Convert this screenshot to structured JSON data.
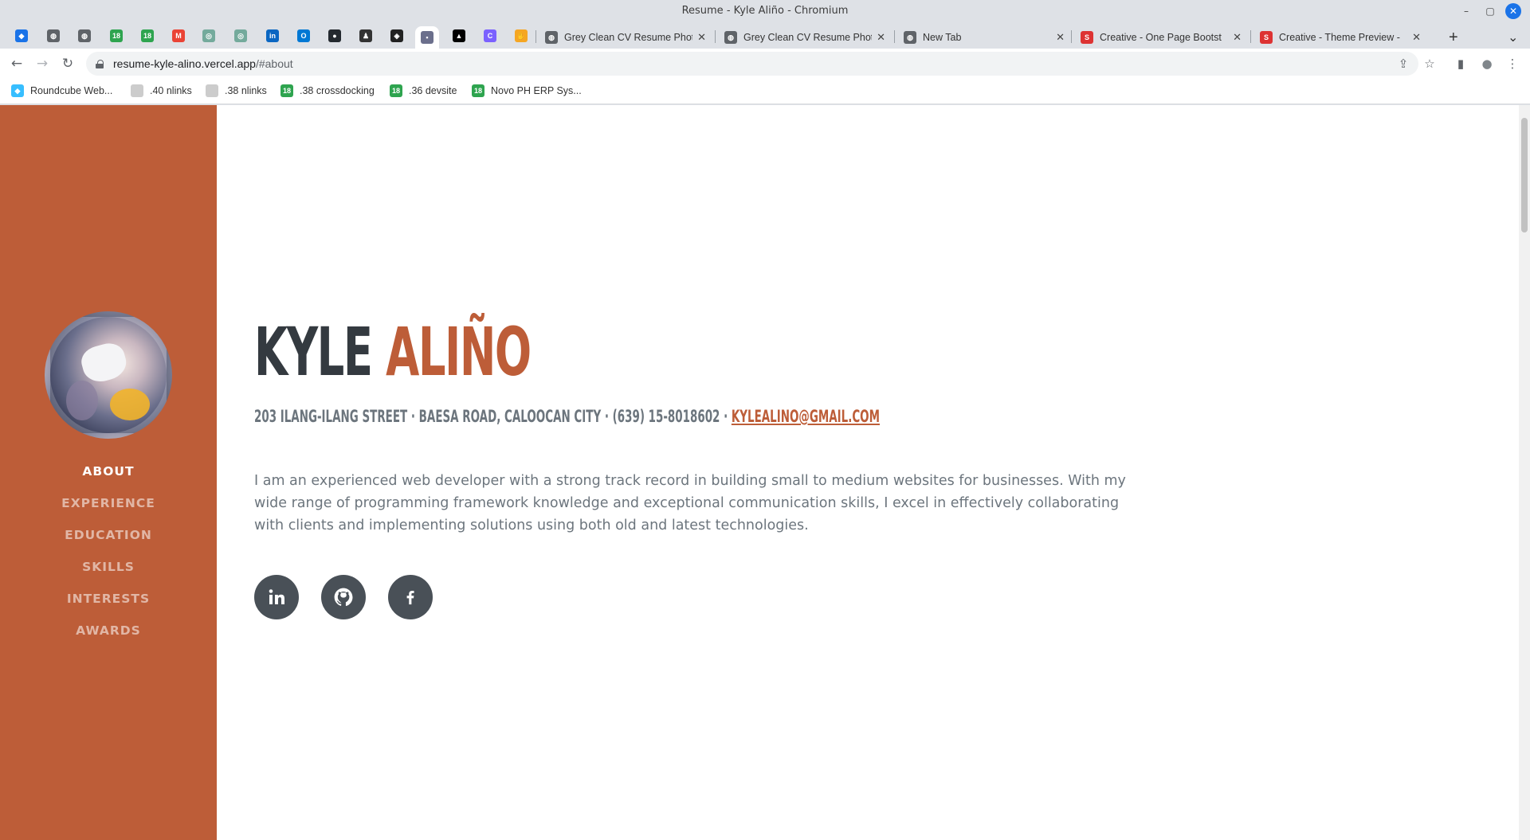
{
  "window": {
    "title": "Resume - Kyle Aliño - Chromium",
    "minimize": "–",
    "maximize": "▢",
    "close": "✕"
  },
  "pinned_tabs": [
    {
      "icon": "bird-icon",
      "color": "#1a73e8",
      "glyph": "◆"
    },
    {
      "icon": "globe-icon",
      "color": "#5f6368",
      "glyph": "◍"
    },
    {
      "icon": "globe-icon",
      "color": "#5f6368",
      "glyph": "◍"
    },
    {
      "icon": "tracker-icon",
      "color": "#2ea44f",
      "glyph": "18"
    },
    {
      "icon": "tracker-icon",
      "color": "#2ea44f",
      "glyph": "18"
    },
    {
      "icon": "gmail-icon",
      "color": "#ea4335",
      "glyph": "M"
    },
    {
      "icon": "chatgpt-icon",
      "color": "#74aa9c",
      "glyph": "◎"
    },
    {
      "icon": "chatgpt-icon",
      "color": "#74aa9c",
      "glyph": "◎"
    },
    {
      "icon": "linkedin-icon",
      "color": "#0a66c2",
      "glyph": "in"
    },
    {
      "icon": "outlook-icon",
      "color": "#0078d4",
      "glyph": "O"
    },
    {
      "icon": "github-icon",
      "color": "#24292f",
      "glyph": "●"
    },
    {
      "icon": "agent-icon",
      "color": "#333333",
      "glyph": "♟"
    },
    {
      "icon": "owl-icon",
      "color": "#222222",
      "glyph": "◈"
    },
    {
      "icon": "profile-photo-icon",
      "color": "#6b6f8c",
      "glyph": "▪"
    },
    {
      "icon": "vercel-icon",
      "color": "#000000",
      "glyph": "▲"
    },
    {
      "icon": "canva-icon",
      "color": "#7b61ff",
      "glyph": "C"
    },
    {
      "icon": "hand-icon",
      "color": "#f5a623",
      "glyph": "✋"
    }
  ],
  "tabs": [
    {
      "label": "Grey Clean CV Resume Phot",
      "icon": "globe-icon",
      "color": "#5f6368",
      "glyph": "◍"
    },
    {
      "label": "Grey Clean CV Resume Phot",
      "icon": "globe-icon",
      "color": "#5f6368",
      "glyph": "◍"
    },
    {
      "label": "New Tab",
      "icon": "globe-icon",
      "color": "#5f6368",
      "glyph": "◍"
    },
    {
      "label": "Creative - One Page Bootst",
      "icon": "startbootstrap-icon",
      "color": "#dd3333",
      "glyph": "S"
    },
    {
      "label": "Creative - Theme Preview -",
      "icon": "startbootstrap-icon",
      "color": "#dd3333",
      "glyph": "S"
    }
  ],
  "tab_close": "✕",
  "new_tab": "+",
  "tab_search": "⌄",
  "address": {
    "host": "resume-kyle-alino.vercel.app",
    "path": "/#about"
  },
  "nav_glyphs": {
    "back": "←",
    "forward": "→",
    "reload": "↻",
    "share": "⇪",
    "star": "☆",
    "sidepanel": "▮",
    "profile": "●",
    "menu": "⋮"
  },
  "bookmarks": [
    {
      "label": "Roundcube Web...",
      "icon": "roundcube-icon",
      "color": "#37beff",
      "glyph": "◆"
    },
    {
      "label": ".40 nlinks",
      "icon": "page-icon",
      "color": "#cccccc",
      "glyph": ""
    },
    {
      "label": ".38 nlinks",
      "icon": "page-icon",
      "color": "#cccccc",
      "glyph": ""
    },
    {
      "label": ".38 crossdocking",
      "icon": "tracker-icon",
      "color": "#2ea44f",
      "glyph": "18"
    },
    {
      "label": ".36 devsite",
      "icon": "tracker-icon",
      "color": "#2ea44f",
      "glyph": "18"
    },
    {
      "label": "Novo PH ERP Sys...",
      "icon": "tracker-icon",
      "color": "#2ea44f",
      "glyph": "18"
    }
  ],
  "sidebar": {
    "accent": "#bd5d38",
    "items": [
      {
        "label": "ABOUT",
        "active": true
      },
      {
        "label": "EXPERIENCE",
        "active": false
      },
      {
        "label": "EDUCATION",
        "active": false
      },
      {
        "label": "SKILLS",
        "active": false
      },
      {
        "label": "INTERESTS",
        "active": false
      },
      {
        "label": "AWARDS",
        "active": false
      }
    ]
  },
  "about": {
    "first_name": "KYLE",
    "last_name": "ALIÑO",
    "address": "203 ILANG-ILANG STREET · BAESA ROAD, CALOOCAN CITY · (639) 15-8018602 · ",
    "email": "KYLEALINO@GMAIL.COM",
    "intro": "I am an experienced web developer with a strong track record in building small to medium websites for businesses. With my wide range of programming framework knowledge and exceptional communication skills, I excel in effectively collaborating with clients and implementing solutions using both old and latest technologies.",
    "socials": [
      {
        "name": "linkedin",
        "icon": "linkedin-icon"
      },
      {
        "name": "github",
        "icon": "github-icon"
      },
      {
        "name": "facebook",
        "icon": "facebook-icon"
      }
    ]
  }
}
